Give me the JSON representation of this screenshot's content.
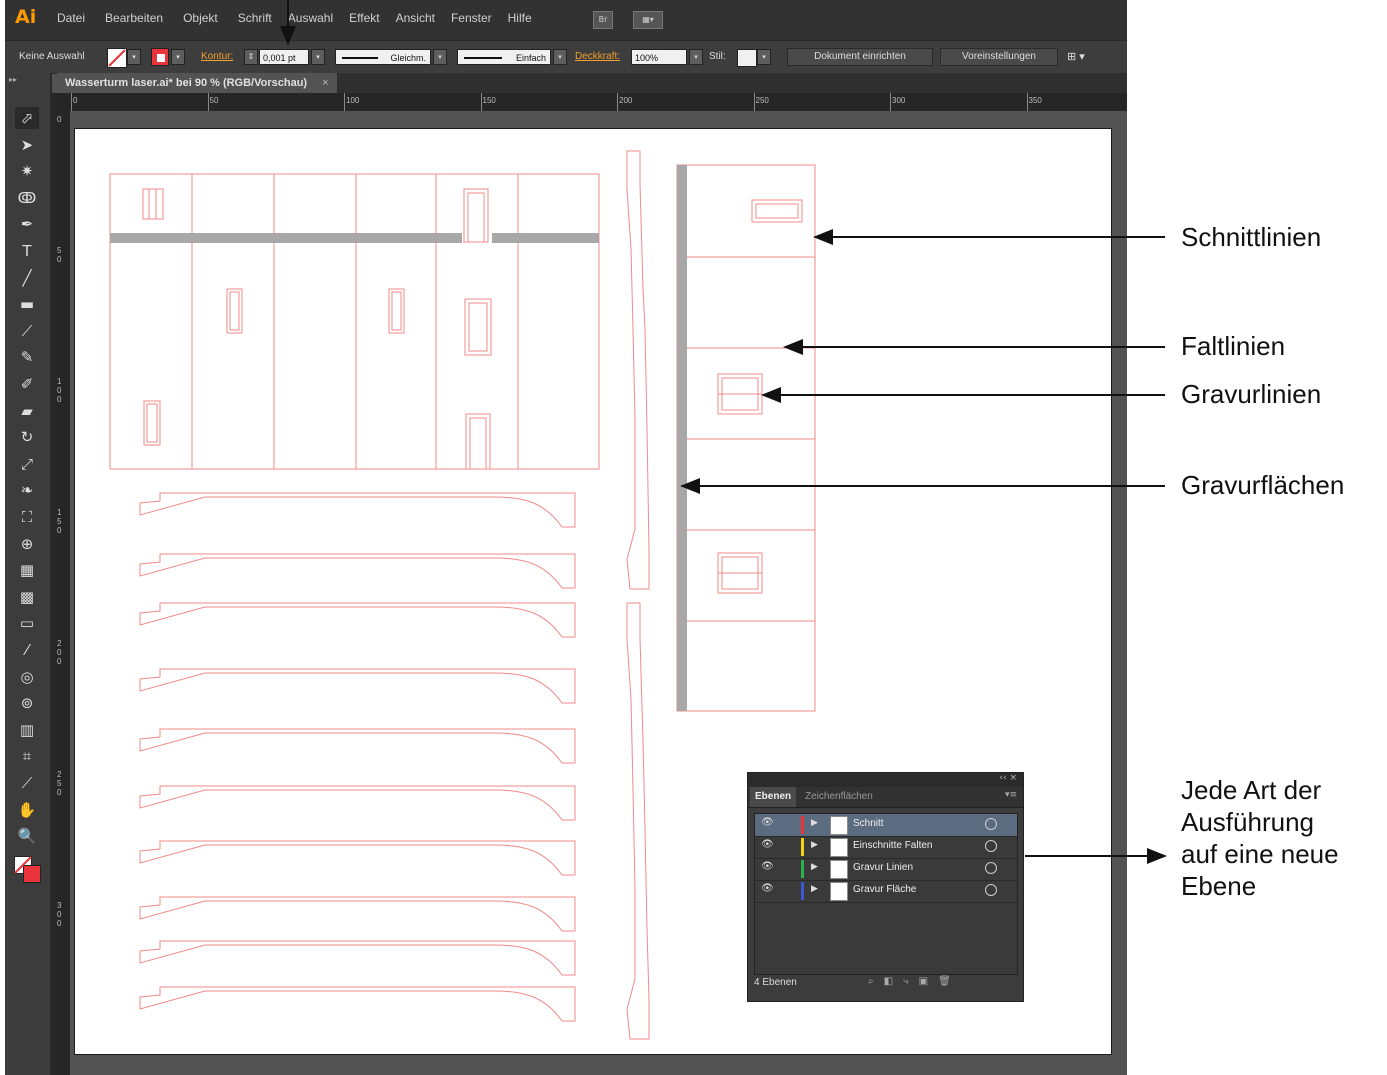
{
  "app": {
    "logo": "Ai"
  },
  "menubar": {
    "items": [
      "Datei",
      "Bearbeiten",
      "Objekt",
      "Schrift",
      "Auswahl",
      "Effekt",
      "Ansicht",
      "Fenster",
      "Hilfe"
    ],
    "bridge_icon": "Br"
  },
  "control_bar": {
    "selection": "Keine Auswahl",
    "kontur_label": "Kontur:",
    "stroke_weight": "0,001 pt",
    "profile": "Gleichm.",
    "brush": "Einfach",
    "opacity_label": "Deckkraft:",
    "opacity": "100%",
    "style_label": "Stil:",
    "doc_setup": "Dokument einrichten",
    "prefs": "Voreinstellungen"
  },
  "document": {
    "tab_title": "Wasserturm laser.ai* bei 90 % (RGB/Vorschau)",
    "close": "×"
  },
  "ruler": {
    "h_ticks": [
      "0",
      "50",
      "100",
      "150",
      "200",
      "250",
      "300",
      "350"
    ],
    "v_ticks": [
      [
        "0"
      ],
      [
        "5",
        "0"
      ],
      [
        "1",
        "0",
        "0"
      ],
      [
        "1",
        "5",
        "0"
      ],
      [
        "2",
        "0",
        "0"
      ],
      [
        "2",
        "5",
        "0"
      ],
      [
        "3",
        "0",
        "0"
      ]
    ]
  },
  "tools": [
    {
      "icon": "selection-tool-icon",
      "glyph": "⬀"
    },
    {
      "icon": "direct-selection-tool-icon",
      "glyph": "➤"
    },
    {
      "icon": "magic-wand-icon",
      "glyph": "✷"
    },
    {
      "icon": "lasso-icon",
      "glyph": "ↂ"
    },
    {
      "icon": "pen-tool-icon",
      "glyph": "✒"
    },
    {
      "icon": "type-tool-icon",
      "glyph": "T"
    },
    {
      "icon": "line-tool-icon",
      "glyph": "╱"
    },
    {
      "icon": "rectangle-tool-icon",
      "glyph": "▬"
    },
    {
      "icon": "paintbrush-icon",
      "glyph": "⟋"
    },
    {
      "icon": "pencil-icon",
      "glyph": "✎"
    },
    {
      "icon": "blob-brush-icon",
      "glyph": "✐"
    },
    {
      "icon": "eraser-icon",
      "glyph": "▰"
    },
    {
      "icon": "rotate-tool-icon",
      "glyph": "↻"
    },
    {
      "icon": "scale-tool-icon",
      "glyph": "⤢"
    },
    {
      "icon": "warp-tool-icon",
      "glyph": "❧"
    },
    {
      "icon": "free-transform-icon",
      "glyph": "⛶"
    },
    {
      "icon": "shape-builder-icon",
      "glyph": "⊕"
    },
    {
      "icon": "perspective-grid-icon",
      "glyph": "▦"
    },
    {
      "icon": "mesh-tool-icon",
      "glyph": "▩"
    },
    {
      "icon": "gradient-tool-icon",
      "glyph": "▭"
    },
    {
      "icon": "eyedropper-icon",
      "glyph": "⁄"
    },
    {
      "icon": "blend-tool-icon",
      "glyph": "◎"
    },
    {
      "icon": "symbol-sprayer-icon",
      "glyph": "⊚"
    },
    {
      "icon": "column-graph-icon",
      "glyph": "▥"
    },
    {
      "icon": "artboard-tool-icon",
      "glyph": "⌗"
    },
    {
      "icon": "slice-tool-icon",
      "glyph": "⟋"
    },
    {
      "icon": "hand-tool-icon",
      "glyph": "✋"
    },
    {
      "icon": "zoom-tool-icon",
      "glyph": "🔍"
    }
  ],
  "layers_panel": {
    "tab_active": "Ebenen",
    "tab_inactive": "Zeichenflächen",
    "collapse": "‹‹ ×",
    "layers": [
      {
        "name": "Schnitt",
        "color": "#e8343a"
      },
      {
        "name": "Einschnitte Falten",
        "color": "#f2d41a"
      },
      {
        "name": "Gravur Linien",
        "color": "#2ab34a"
      },
      {
        "name": "Gravur Fläche",
        "color": "#3a56d4"
      }
    ],
    "status": "4 Ebenen"
  },
  "annotations": {
    "cut_lines": "Schnittlinien",
    "fold_lines": "Faltlinien",
    "engrave_lines": "Gravurlinien",
    "engrave_areas": "Gravurflächen",
    "layers_note": [
      "Jede Art der",
      "Ausführung",
      "auf eine neue",
      "Ebene"
    ]
  },
  "colors": {
    "cut": "#e8343a",
    "engrave_fill": "#a8a8a8",
    "accent": "#ff9a00"
  }
}
